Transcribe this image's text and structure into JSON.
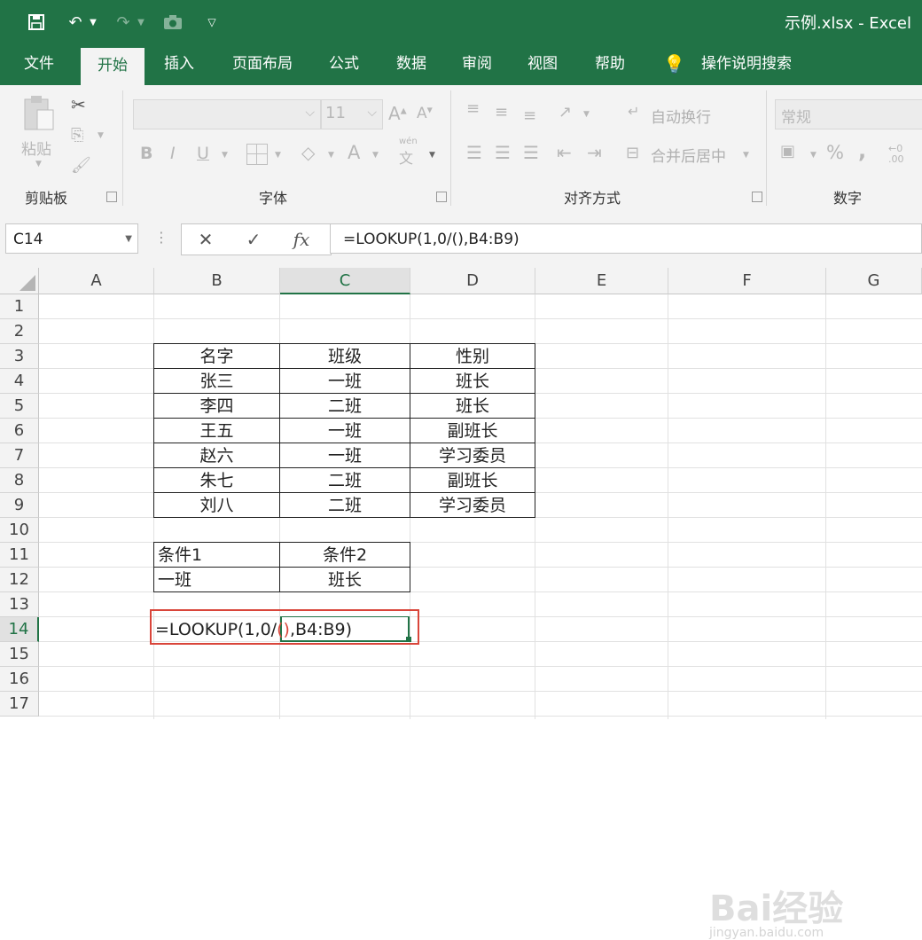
{
  "title_bar": {
    "title": "示例.xlsx  -  Excel"
  },
  "menu": {
    "tabs": [
      "文件",
      "开始",
      "插入",
      "页面布局",
      "公式",
      "数据",
      "审阅",
      "视图",
      "帮助"
    ],
    "active_tab": "开始",
    "tell_me": "操作说明搜索"
  },
  "ribbon": {
    "clipboard": {
      "paste": "粘贴",
      "label": "剪贴板"
    },
    "font": {
      "size": "11",
      "label": "字体",
      "bold": "B",
      "italic": "I",
      "underline": "U",
      "font_color": "A",
      "wen": "wén",
      "wen_char": "文"
    },
    "alignment": {
      "wrap": "自动换行",
      "merge": "合并后居中",
      "label": "对齐方式"
    },
    "number": {
      "format": "常规",
      "label": "数字",
      "percent": "%",
      "comma": ",",
      "decimals": "←0 .00"
    }
  },
  "formula_bar": {
    "name_box": "C14",
    "formula": "=LOOKUP(1,0/(),B4:B9)",
    "fx": "fx"
  },
  "grid": {
    "columns": [
      "A",
      "B",
      "C",
      "D",
      "E",
      "F",
      "G"
    ],
    "selected_column": "C",
    "rows": [
      "1",
      "2",
      "3",
      "4",
      "5",
      "6",
      "7",
      "8",
      "9",
      "10",
      "11",
      "12",
      "13",
      "14",
      "15",
      "16",
      "17"
    ],
    "selected_row": "14",
    "table_header": [
      "名字",
      "班级",
      "性别"
    ],
    "table_rows": [
      [
        "张三",
        "一班",
        "班长"
      ],
      [
        "李四",
        "二班",
        "班长"
      ],
      [
        "王五",
        "一班",
        "副班长"
      ],
      [
        "赵六",
        "一班",
        "学习委员"
      ],
      [
        "朱七",
        "二班",
        "副班长"
      ],
      [
        "刘八",
        "二班",
        "学习委员"
      ]
    ],
    "criteria": {
      "header1": "条件1",
      "header2": "条件2",
      "value1": "一班",
      "value2": "班长"
    },
    "editing_cell": {
      "prefix": "=LOOKUP(1,0/",
      "paren_open": "(",
      "paren_close": ")",
      "suffix": ",B4:B9)"
    }
  },
  "watermark": {
    "text": "Bai经验",
    "sub": "jingyan.baidu.com"
  },
  "colors": {
    "excel_green": "#217346",
    "highlight_red": "#d9453a"
  }
}
